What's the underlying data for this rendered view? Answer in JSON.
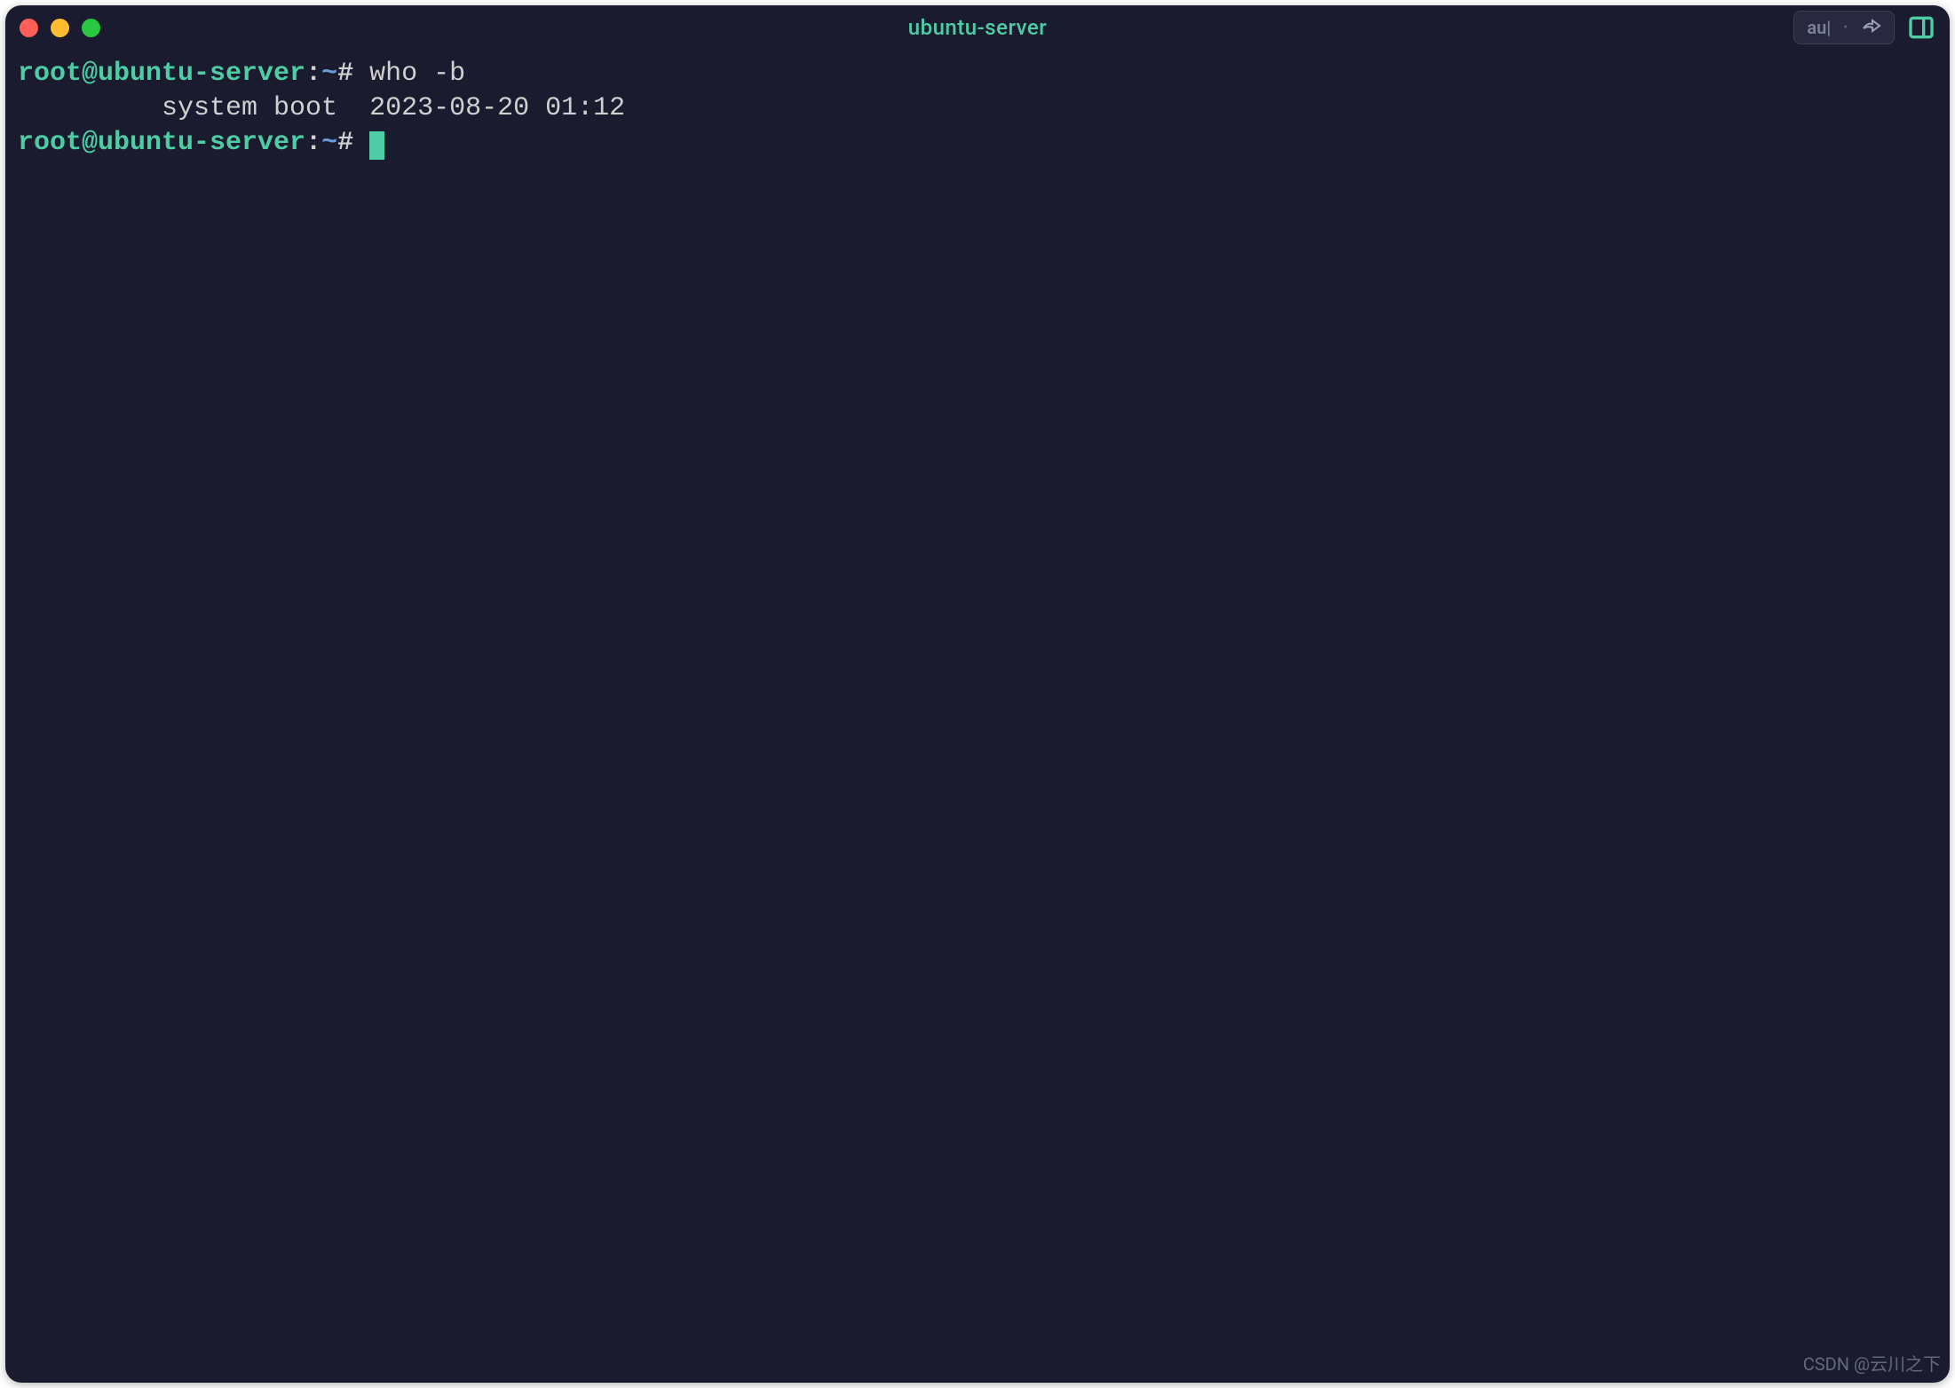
{
  "window": {
    "title": "ubuntu-server"
  },
  "titlebar": {
    "right_badge": "au|"
  },
  "terminal": {
    "lines": [
      {
        "type": "prompt",
        "user_host": "root@ubuntu-server",
        "colon": ":",
        "path": "~",
        "hash": "#",
        "command": " who -b"
      },
      {
        "type": "output",
        "text": "         system boot  2023-08-20 01:12"
      },
      {
        "type": "prompt",
        "user_host": "root@ubuntu-server",
        "colon": ":",
        "path": "~",
        "hash": "#",
        "command": " ",
        "cursor": true
      }
    ]
  },
  "watermark": "CSDN @云川之下"
}
